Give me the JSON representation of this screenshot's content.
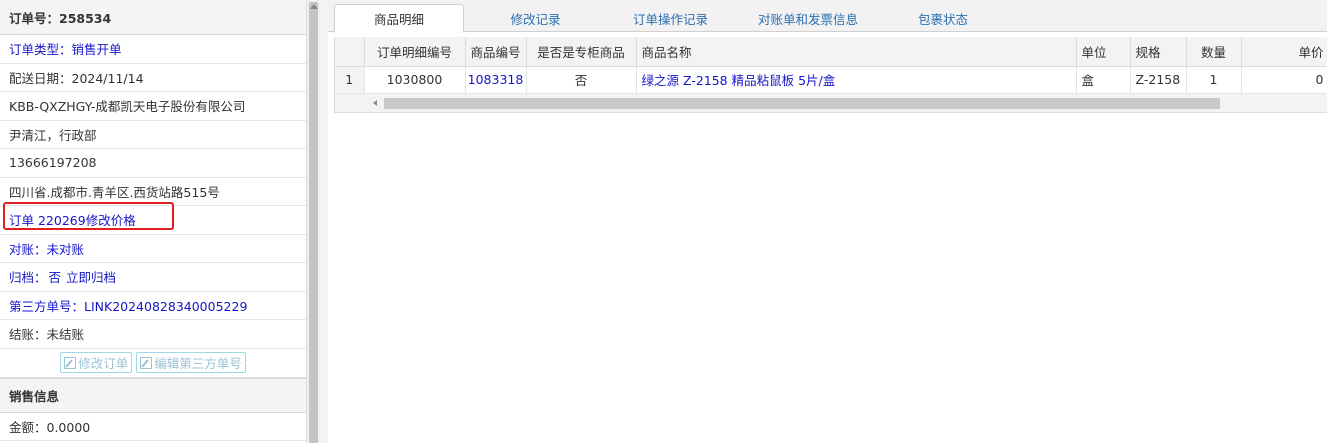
{
  "order": {
    "header": "订单号：258534",
    "type": "订单类型：销售开单",
    "delivery_date": "配送日期：2024/11/14",
    "company": "KBB-QXZHGY-成都凯天电子股份有限公司",
    "contact": "尹清江，行政部",
    "phone": "13666197208",
    "address": "四川省.成都市.青羊区.西货站路515号",
    "price_change": "订单 220269修改价格",
    "reconcile": "对账：未对账",
    "archive_label": "归档：",
    "archive_status": "否",
    "archive_link": "立即归档",
    "third_party": "第三方单号：LINK20240828340005229",
    "settle": "结账：未结账",
    "edit_order_btn": "修改订单",
    "edit_third_btn": "编辑第三方单号"
  },
  "sales": {
    "header": "销售信息",
    "amount": "金额：0.0000"
  },
  "tabs": [
    "商品明细",
    "修改记录",
    "订单操作记录",
    "对账单和发票信息",
    "包裹状态"
  ],
  "grid": {
    "columns": [
      "",
      "订单明细编号",
      "商品编号",
      "是否是专柜商品",
      "商品名称",
      "单位",
      "规格",
      "数量",
      "单价"
    ],
    "rows": [
      [
        "1",
        "1030800",
        "1083318",
        "否",
        "绿之源 Z-2158 精品粘鼠板 5片/盒",
        "盒",
        "Z-2158",
        "1",
        "0"
      ]
    ]
  },
  "icons": [
    "edit-icon",
    "scroll-up-arrow-icon",
    "scroll-left-arrow-icon"
  ],
  "colors": {
    "link": "#1515c8",
    "tab_text": "#2c6fb0",
    "highlight": "#e02020"
  }
}
